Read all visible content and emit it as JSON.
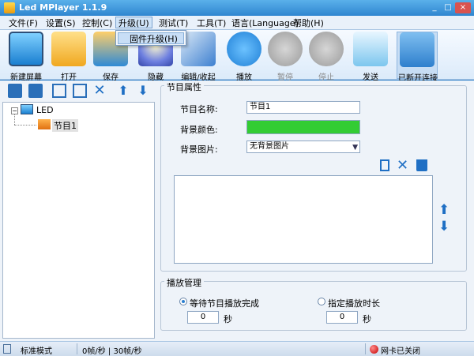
{
  "window": {
    "title": "Led MPlayer 1.1.9",
    "controls": [
      "_",
      "□",
      "×"
    ]
  },
  "menu": [
    {
      "label": "文件(F)"
    },
    {
      "label": "设置(S)"
    },
    {
      "label": "控制(C)"
    },
    {
      "label": "升级(U)"
    },
    {
      "label": "测试(T)"
    },
    {
      "label": "工具(T)"
    },
    {
      "label": "语言(Language)"
    },
    {
      "label": "帮助(H)"
    }
  ],
  "dropdown": {
    "item": "固件升级(H)"
  },
  "toolbar": [
    {
      "label": "新建屏幕",
      "icon": "monitor-icon"
    },
    {
      "label": "打开",
      "icon": "open-folder-icon"
    },
    {
      "label": "保存",
      "icon": "save-icon"
    },
    {
      "label": "隐藏",
      "icon": "lightbulb-icon"
    },
    {
      "label": "编辑/收起",
      "icon": "pencil-icon"
    },
    {
      "label": "播放",
      "icon": "play-icon"
    },
    {
      "label": "暂停",
      "icon": "pause-icon"
    },
    {
      "label": "停止",
      "icon": "stop-icon"
    },
    {
      "label": "发送",
      "icon": "send-cloud-icon"
    },
    {
      "label": "已断开连接",
      "icon": "disconnected-icon"
    }
  ],
  "tree": {
    "root": "LED",
    "child": "节目1"
  },
  "program_props": {
    "group_title": "节目属性",
    "name_label": "节目名称:",
    "name_value": "节目1",
    "bg_color_label": "背景颜色:",
    "bg_color": "#33cc33",
    "bg_image_label": "背景图片:",
    "bg_image_value": "无背景图片"
  },
  "play_manage": {
    "group_title": "播放管理",
    "option1": "等待节目播放完成",
    "option2": "指定播放时长",
    "value1": "0",
    "value2": "0",
    "unit": "秒"
  },
  "status": {
    "mode": "标准模式",
    "fps": "0帧/秒 | 30帧/秒",
    "net": "网卡已关闭"
  }
}
